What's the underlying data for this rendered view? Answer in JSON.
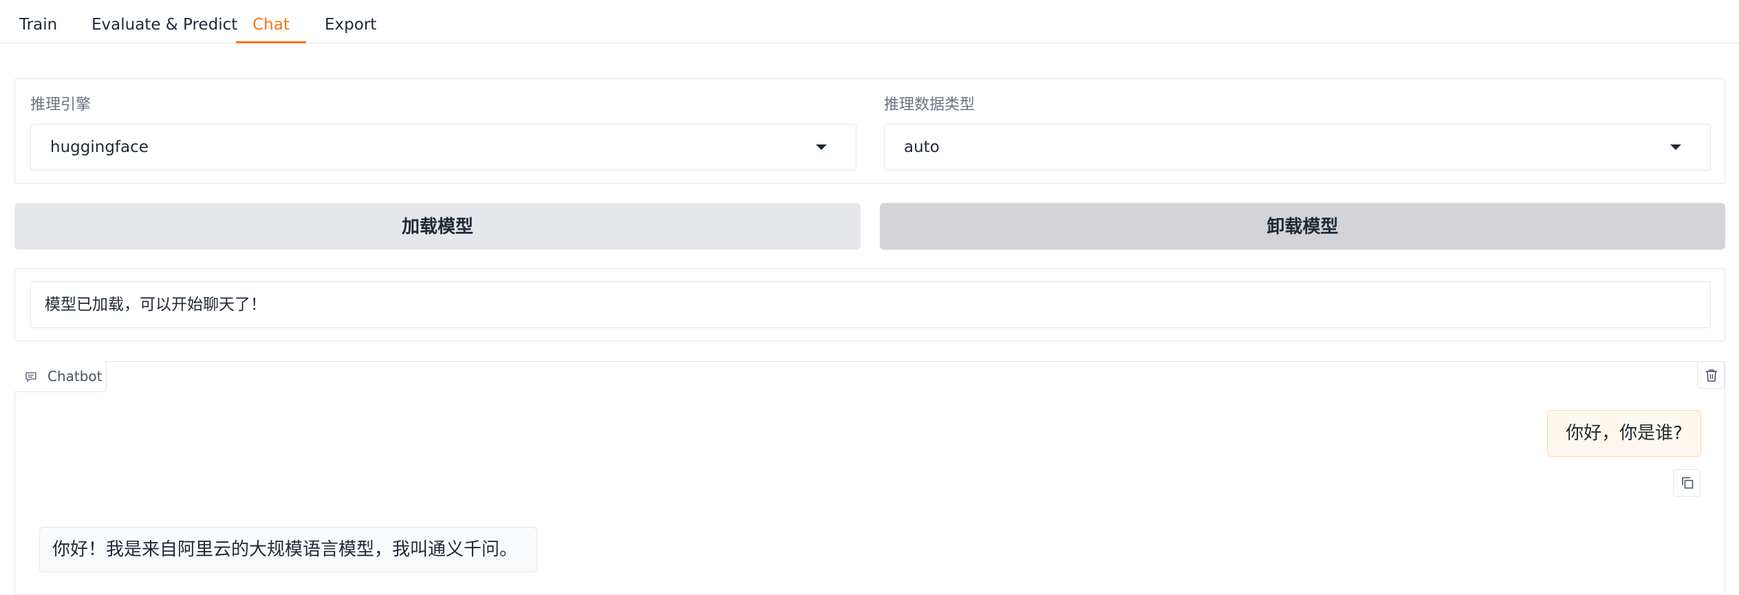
{
  "tabs": [
    {
      "label": "Train",
      "active": false
    },
    {
      "label": "Evaluate & Predict",
      "active": false
    },
    {
      "label": "Chat",
      "active": true
    },
    {
      "label": "Export",
      "active": false
    }
  ],
  "accent_color": "#f97316",
  "inference": {
    "engine": {
      "label": "推理引擎",
      "value": "huggingface"
    },
    "dtype": {
      "label": "推理数据类型",
      "value": "auto"
    }
  },
  "buttons": {
    "load_model": "加载模型",
    "unload_model": "卸载模型"
  },
  "status_message": "模型已加载，可以开始聊天了！",
  "chatbot": {
    "label": "Chatbot",
    "messages": [
      {
        "role": "user",
        "text": "你好，你是谁?"
      },
      {
        "role": "assistant",
        "text": "你好！我是来自阿里云的大规模语言模型，我叫通义千问。"
      }
    ]
  },
  "icons": {
    "chatbot": "chat-bubble-icon",
    "clear": "trash-icon",
    "copy": "copy-icon"
  }
}
